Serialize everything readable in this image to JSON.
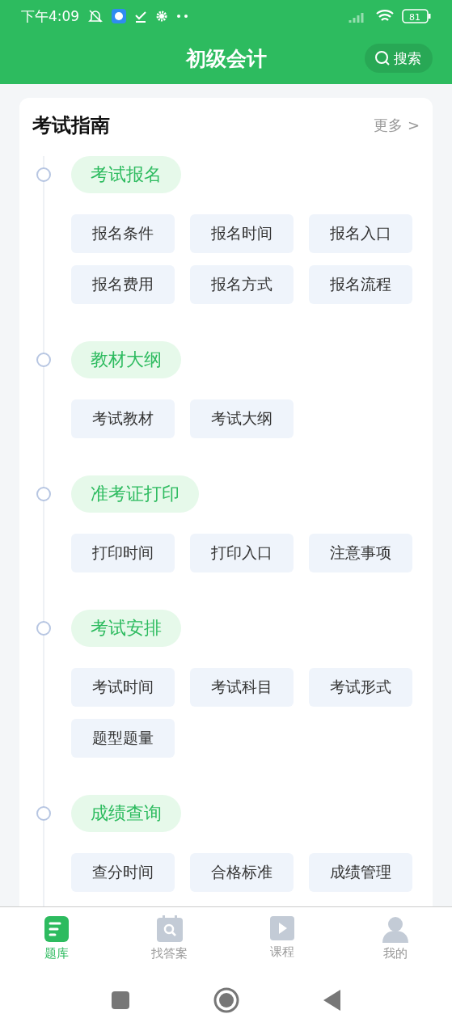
{
  "status_bar": {
    "time": "下午4:09",
    "battery": "81"
  },
  "header": {
    "title": "初级会计",
    "search": {
      "label": "搜索"
    }
  },
  "guide": {
    "title": "考试指南",
    "more": "更多 >",
    "sections": [
      {
        "title": "考试报名",
        "items": [
          "报名条件",
          "报名时间",
          "报名入口",
          "报名费用",
          "报名方式",
          "报名流程"
        ]
      },
      {
        "title": "教材大纲",
        "items": [
          "考试教材",
          "考试大纲"
        ]
      },
      {
        "title": "准考证打印",
        "items": [
          "打印时间",
          "打印入口",
          "注意事项"
        ]
      },
      {
        "title": "考试安排",
        "items": [
          "考试时间",
          "考试科目",
          "考试形式",
          "题型题量"
        ]
      },
      {
        "title": "成绩查询",
        "items": [
          "查分时间",
          "合格标准",
          "成绩管理"
        ]
      }
    ]
  },
  "tab_bar": [
    {
      "kind": "bank",
      "label": "题库",
      "selected": true
    },
    {
      "kind": "answers",
      "label": "找答案",
      "selected": false
    },
    {
      "kind": "course",
      "label": "课程",
      "selected": false
    },
    {
      "kind": "me",
      "label": "我的",
      "selected": false
    }
  ]
}
